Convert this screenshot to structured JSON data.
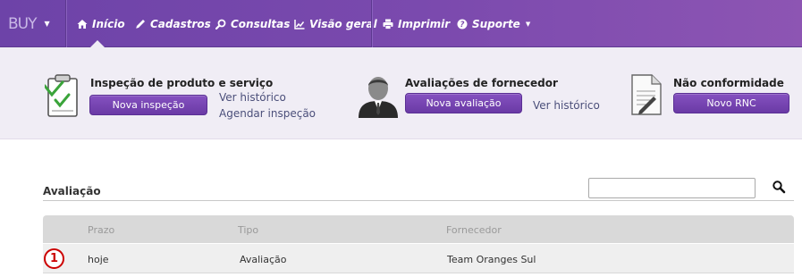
{
  "navbar": {
    "brand": "BUY",
    "items": [
      {
        "label": "Início",
        "icon": "home-icon"
      },
      {
        "label": "Cadastros",
        "icon": "pencil-icon"
      },
      {
        "label": "Consultas",
        "icon": "search-icon"
      },
      {
        "label": "Visão geral",
        "icon": "chart-icon"
      },
      {
        "label": "Imprimir",
        "icon": "printer-icon"
      },
      {
        "label": "Suporte",
        "icon": "help-icon"
      }
    ],
    "accent": "#7b4aae"
  },
  "banner": {
    "inspecao": {
      "title": "Inspeção de produto e serviço",
      "button": "Nova inspeção",
      "links": [
        "Ver histórico",
        "Agendar inspeção"
      ],
      "icon": "clipboard-check-icon"
    },
    "avaliacoes": {
      "title": "Avaliações de fornecedor",
      "button": "Nova avaliação",
      "links": [
        "Ver histórico"
      ],
      "icon": "person-icon"
    },
    "rnc": {
      "title": "Não conformidade",
      "button": "Novo RNC",
      "icon": "document-icon"
    }
  },
  "content": {
    "section_title": "Avaliação",
    "search": {
      "value": "",
      "placeholder": ""
    },
    "table": {
      "columns": [
        "Prazo",
        "Tipo",
        "Fornecedor"
      ],
      "rows": [
        {
          "badge": "1",
          "cells": [
            "hoje",
            "Avaliação",
            "Team Oranges Sul"
          ]
        }
      ]
    },
    "badge_color": "#cc0000"
  }
}
